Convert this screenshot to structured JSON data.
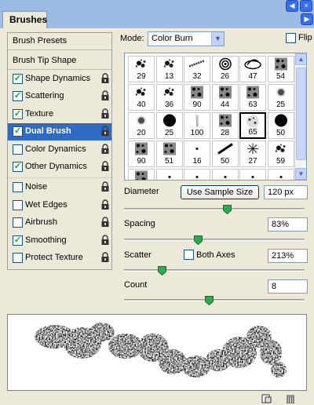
{
  "tab": {
    "label": "Brushes"
  },
  "left_panel": {
    "header_items": [
      {
        "label": "Brush Presets"
      },
      {
        "label": "Brush Tip Shape"
      }
    ],
    "options": [
      {
        "label": "Shape Dynamics",
        "checked": true,
        "selected": false
      },
      {
        "label": "Scattering",
        "checked": true,
        "selected": false
      },
      {
        "label": "Texture",
        "checked": true,
        "selected": false
      },
      {
        "label": "Dual Brush",
        "checked": true,
        "selected": true
      },
      {
        "label": "Color Dynamics",
        "checked": false,
        "selected": false
      },
      {
        "label": "Other Dynamics",
        "checked": true,
        "selected": false
      },
      {
        "label": "Noise",
        "checked": false,
        "selected": false
      },
      {
        "label": "Wet Edges",
        "checked": false,
        "selected": false
      },
      {
        "label": "Airbrush",
        "checked": false,
        "selected": false
      },
      {
        "label": "Smoothing",
        "checked": true,
        "selected": false
      },
      {
        "label": "Protect Texture",
        "checked": false,
        "selected": false
      }
    ]
  },
  "mode": {
    "label": "Mode:",
    "value": "Color Burn"
  },
  "flip": {
    "label": "Flip",
    "checked": false
  },
  "brushes": {
    "tiles": [
      {
        "size": "29",
        "shape": "splatter"
      },
      {
        "size": "13",
        "shape": "splatter"
      },
      {
        "size": "32",
        "shape": "streak"
      },
      {
        "size": "26",
        "shape": "rings"
      },
      {
        "size": "47",
        "shape": "swirl"
      },
      {
        "size": "54",
        "shape": "texture"
      },
      {
        "size": "40",
        "shape": "splatter"
      },
      {
        "size": "36",
        "shape": "splatter"
      },
      {
        "size": "90",
        "shape": "texture"
      },
      {
        "size": "44",
        "shape": "texture"
      },
      {
        "size": "63",
        "shape": "texture"
      },
      {
        "size": "25",
        "shape": "soft-dot"
      },
      {
        "size": "20",
        "shape": "soft-dot"
      },
      {
        "size": "25",
        "shape": "hard-dot"
      },
      {
        "size": "100",
        "shape": "streak-v"
      },
      {
        "size": "28",
        "shape": "texture"
      },
      {
        "size": "65",
        "shape": "splatter-light"
      },
      {
        "size": "50",
        "shape": "hard-dot"
      },
      {
        "size": "90",
        "shape": "texture"
      },
      {
        "size": "51",
        "shape": "texture"
      },
      {
        "size": "16",
        "shape": "tiny"
      },
      {
        "size": "50",
        "shape": "streak-d"
      },
      {
        "size": "27",
        "shape": "star"
      },
      {
        "size": "59",
        "shape": "splatter"
      },
      {
        "size": "",
        "shape": "texture"
      },
      {
        "size": "",
        "shape": "tiny"
      },
      {
        "size": "",
        "shape": "tiny"
      },
      {
        "size": "",
        "shape": "tiny"
      },
      {
        "size": "",
        "shape": "tiny"
      },
      {
        "size": "",
        "shape": "tiny"
      }
    ],
    "selected_size": "65"
  },
  "diameter": {
    "label": "Diameter",
    "button": "Use Sample Size",
    "value": "120 px",
    "slider": 0.57
  },
  "spacing": {
    "label": "Spacing",
    "value": "83%",
    "slider": 0.41
  },
  "scatter": {
    "label": "Scatter",
    "both_axes_label": "Both Axes",
    "both_axes_checked": false,
    "value": "213%",
    "slider": 0.21
  },
  "count": {
    "label": "Count",
    "value": "8",
    "slider": 0.47
  },
  "icons": {
    "lock": "lock-icon",
    "new_brush": "new-brush-icon",
    "trash": "trash-icon"
  },
  "colors": {
    "selection": "#316ac5",
    "check": "#21a121",
    "panel": "#ece9d8",
    "titlebar": "#9ebbe6"
  }
}
